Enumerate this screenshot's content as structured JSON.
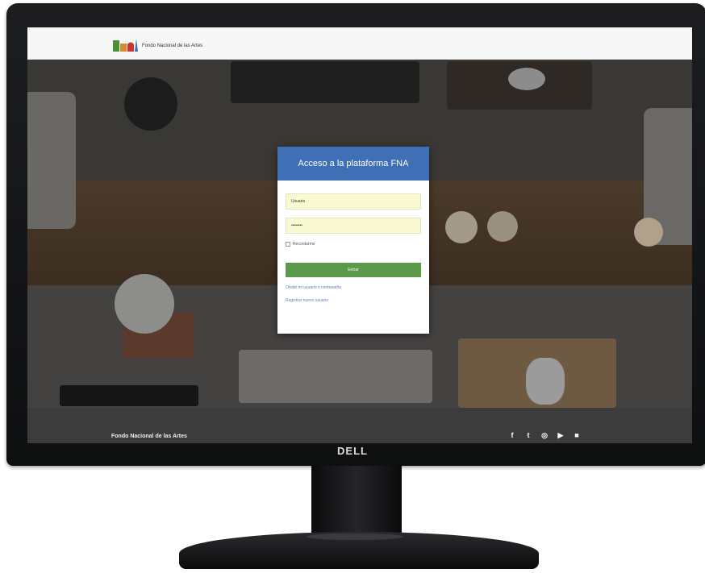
{
  "monitor": {
    "brand": "DELL"
  },
  "header": {
    "logo_text": "Fondo Nacional de las Artes"
  },
  "login": {
    "title": "Acceso a la plataforma FNA",
    "username_value": "Usuario",
    "password_value": "••••••••",
    "remember_label": "Recordarme",
    "submit_label": "Entrar",
    "forgot_link": "Olvidé mi usuario o contraseña",
    "register_link": "Registrar nuevo usuario"
  },
  "footer": {
    "name": "Fondo Nacional de las Artes",
    "social": [
      "f",
      "t",
      "◎",
      "▶",
      "■"
    ]
  },
  "colors": {
    "login_header": "#3f6fb5",
    "submit_button": "#5a9a4a",
    "input_fill": "#fafad2",
    "footer_bg": "#3c3c3c"
  }
}
